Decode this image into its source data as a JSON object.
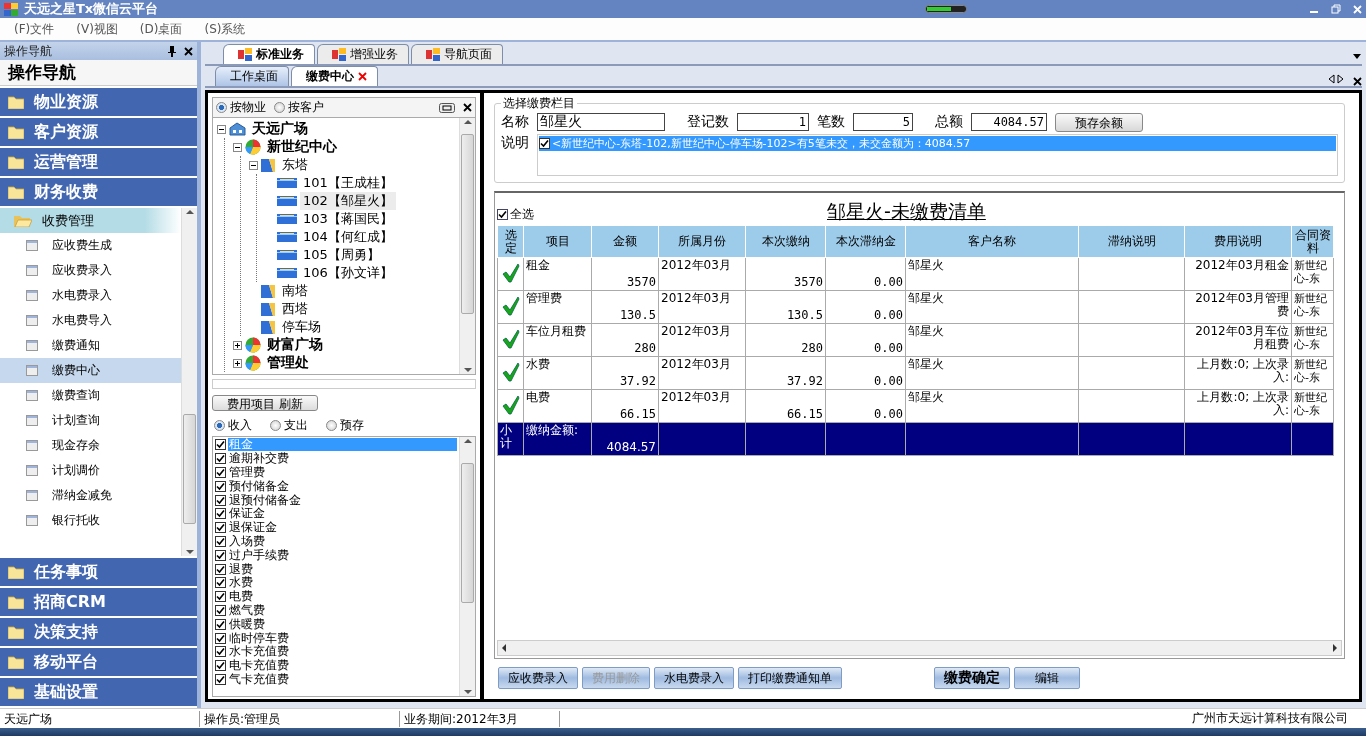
{
  "window": {
    "title": "天远之星Tx微信云平台"
  },
  "menu": [
    "(F)文件",
    "(V)视图",
    "(D)桌面",
    "(S)系统"
  ],
  "nav": {
    "header": "操作导航",
    "title": "操作导航",
    "groups": [
      {
        "label": "物业资源"
      },
      {
        "label": "客户资源"
      },
      {
        "label": "运营管理"
      },
      {
        "label": "财务收费",
        "children": [
          {
            "label": "收费管理",
            "expanded": true,
            "children": [
              {
                "label": "应收费生成",
                "selected": false
              },
              {
                "label": "应收费录入",
                "selected": false
              },
              {
                "label": "水电费录入",
                "selected": false
              },
              {
                "label": "水电费导入",
                "selected": false
              },
              {
                "label": "缴费通知",
                "selected": false
              },
              {
                "label": "缴费中心",
                "selected": true
              },
              {
                "label": "缴费查询",
                "selected": false
              },
              {
                "label": "计划查询",
                "selected": false
              },
              {
                "label": "现金存余",
                "selected": false
              },
              {
                "label": "计划调价",
                "selected": false
              },
              {
                "label": "滞纳金减免",
                "selected": false
              },
              {
                "label": "银行托收",
                "selected": false
              }
            ]
          }
        ]
      },
      {
        "label": "任务事项"
      },
      {
        "label": "招商CRM"
      },
      {
        "label": "决策支持"
      },
      {
        "label": "移动平台"
      },
      {
        "label": "基础设置"
      }
    ]
  },
  "main_tabs": [
    {
      "label": "标准业务",
      "selected": true
    },
    {
      "label": "增强业务",
      "selected": false
    },
    {
      "label": "导航页面",
      "selected": false
    }
  ],
  "doc_tabs": [
    {
      "label": "工作桌面",
      "selected": false,
      "closable": false
    },
    {
      "label": "缴费中心",
      "selected": true,
      "closable": true
    }
  ],
  "tree_mode": [
    {
      "label": "按物业",
      "selected": true
    },
    {
      "label": "按客户",
      "selected": false
    }
  ],
  "tree": [
    {
      "label": "天远广场",
      "kind": "root",
      "expanded": true,
      "selected": false,
      "children": [
        {
          "label": "新世纪中心",
          "kind": "site",
          "expanded": true,
          "selected": false,
          "children": [
            {
              "label": "东塔",
              "kind": "tower",
              "expanded": true,
              "selected": false,
              "children": [
                {
                  "label": "101【王成桂】",
                  "kind": "unit",
                  "selected": false
                },
                {
                  "label": "102【邹星火】",
                  "kind": "unit",
                  "selected": true
                },
                {
                  "label": "103【蒋国民】",
                  "kind": "unit",
                  "selected": false
                },
                {
                  "label": "104【何红成】",
                  "kind": "unit",
                  "selected": false
                },
                {
                  "label": "105【周勇】",
                  "kind": "unit",
                  "selected": false
                },
                {
                  "label": "106【孙文详】",
                  "kind": "unit",
                  "selected": false
                }
              ]
            },
            {
              "label": "南塔",
              "kind": "tower",
              "selected": false
            },
            {
              "label": "西塔",
              "kind": "tower",
              "selected": false
            },
            {
              "label": "停车场",
              "kind": "tower",
              "selected": false
            }
          ]
        },
        {
          "label": "财富广场",
          "kind": "site",
          "expanded": false,
          "selected": false
        },
        {
          "label": "管理处",
          "kind": "site",
          "expanded": false,
          "selected": false
        }
      ]
    }
  ],
  "refresh_button": "费用项目 刷新",
  "charge_type": [
    {
      "label": "收入",
      "selected": true
    },
    {
      "label": "支出",
      "selected": false
    },
    {
      "label": "预存",
      "selected": false
    }
  ],
  "charge_items": [
    {
      "label": "租金",
      "checked": true,
      "selected": true
    },
    {
      "label": "逾期补交费",
      "checked": true,
      "selected": false
    },
    {
      "label": "管理费",
      "checked": true,
      "selected": false
    },
    {
      "label": "预付储备金",
      "checked": true,
      "selected": false
    },
    {
      "label": "退预付储备金",
      "checked": true,
      "selected": false
    },
    {
      "label": "保证金",
      "checked": true,
      "selected": false
    },
    {
      "label": "退保证金",
      "checked": true,
      "selected": false
    },
    {
      "label": "入场费",
      "checked": true,
      "selected": false
    },
    {
      "label": "过户手续费",
      "checked": true,
      "selected": false
    },
    {
      "label": "退费",
      "checked": true,
      "selected": false
    },
    {
      "label": "水费",
      "checked": true,
      "selected": false
    },
    {
      "label": "电费",
      "checked": true,
      "selected": false
    },
    {
      "label": "燃气费",
      "checked": true,
      "selected": false
    },
    {
      "label": "供暖费",
      "checked": true,
      "selected": false
    },
    {
      "label": "临时停车费",
      "checked": true,
      "selected": false
    },
    {
      "label": "水卡充值费",
      "checked": true,
      "selected": false
    },
    {
      "label": "电卡充值费",
      "checked": true,
      "selected": false
    },
    {
      "label": "气卡充值费",
      "checked": true,
      "selected": false
    }
  ],
  "form": {
    "legend": "选择缴费栏目",
    "name_label": "名称",
    "name": "邹星火",
    "count_label": "登记数",
    "count": "1",
    "bills_label": "笔数",
    "bills": "5",
    "total_label": "总额",
    "total": "4084.57",
    "balance_button": "预存余额",
    "note_label": "说明",
    "notes": [
      {
        "text": "<新世纪中心-东塔-102,新世纪中心-停车场-102>有5笔未交，未交金额为：4084.57",
        "checked": true,
        "selected": true
      }
    ]
  },
  "grid": {
    "select_all": {
      "label": "全选",
      "checked": true
    },
    "title": "邹星火-未缴费清单",
    "columns": [
      {
        "label": "选定",
        "kind": "check"
      },
      {
        "label": "项目",
        "kind": "text"
      },
      {
        "label": "金额",
        "kind": "amount"
      },
      {
        "label": "所属月份",
        "kind": "text"
      },
      {
        "label": "本次缴纳",
        "kind": "amount"
      },
      {
        "label": "本次滞纳金",
        "kind": "amount"
      },
      {
        "label": "客户名称",
        "kind": "text"
      },
      {
        "label": "滞纳说明",
        "kind": "text"
      },
      {
        "label": "费用说明",
        "kind": "note"
      },
      {
        "label": "合同资料",
        "kind": "text"
      }
    ],
    "rows": [
      {
        "selected": true,
        "cells": [
          "",
          "租金",
          "3570",
          "2012年03月",
          "3570",
          "0.00",
          "邹星火",
          "",
          "2012年03月租金",
          "新世纪心-东"
        ]
      },
      {
        "selected": true,
        "cells": [
          "",
          "管理费",
          "130.5",
          "2012年03月",
          "130.5",
          "0.00",
          "邹星火",
          "",
          "2012年03月管理费",
          "新世纪心-东"
        ]
      },
      {
        "selected": true,
        "cells": [
          "",
          "车位月租费",
          "280",
          "2012年03月",
          "280",
          "0.00",
          "邹星火",
          "",
          "2012年03月车位月租费",
          "新世纪心-东"
        ]
      },
      {
        "selected": true,
        "cells": [
          "",
          "水费",
          "37.92",
          "2012年03月",
          "37.92",
          "0.00",
          "邹星火",
          "",
          "上月数:0; 上次录入:",
          "新世纪心-东"
        ]
      },
      {
        "selected": true,
        "cells": [
          "",
          "电费",
          "66.15",
          "2012年03月",
          "66.15",
          "0.00",
          "邹星火",
          "",
          "上月数:0; 上次录入:",
          "新世纪心-东"
        ]
      }
    ],
    "subtotal": {
      "cells": [
        "小计",
        "缴纳金额:",
        "4084.57"
      ]
    }
  },
  "actions": [
    {
      "label": "应收费录入",
      "disabled": false,
      "kind": "normal"
    },
    {
      "label": "费用删除",
      "disabled": true,
      "kind": "normal"
    },
    {
      "label": "水电费录入",
      "disabled": false,
      "kind": "normal"
    },
    {
      "label": "打印缴费通知单",
      "disabled": false,
      "kind": "normal"
    },
    {
      "label": "缴费确定",
      "disabled": false,
      "kind": "primary"
    },
    {
      "label": "编辑",
      "disabled": false,
      "kind": "normal"
    }
  ],
  "status_bar": [
    "天远广场",
    "操作员:管理员",
    "业务期间:2012年3月",
    "广州市天远计算科技有限公司"
  ]
}
